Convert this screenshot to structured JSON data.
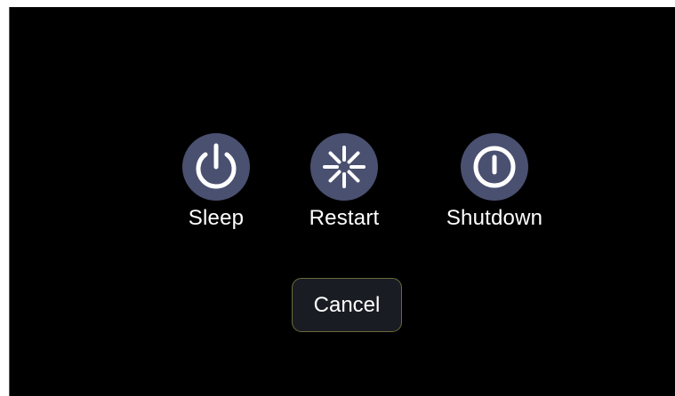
{
  "dialog": {
    "options": [
      {
        "id": "sleep",
        "label": "Sleep",
        "icon": "power-icon"
      },
      {
        "id": "restart",
        "label": "Restart",
        "icon": "restart-spinner-icon"
      },
      {
        "id": "shutdown",
        "label": "Shutdown",
        "icon": "shutdown-icon"
      }
    ],
    "cancel_label": "Cancel"
  },
  "colors": {
    "background": "#000000",
    "icon_circle": "#4a5070",
    "icon_glyph": "#ffffff",
    "text": "#ffffff",
    "cancel_background": "#1a1c24",
    "cancel_border": "#6b6a3a"
  }
}
